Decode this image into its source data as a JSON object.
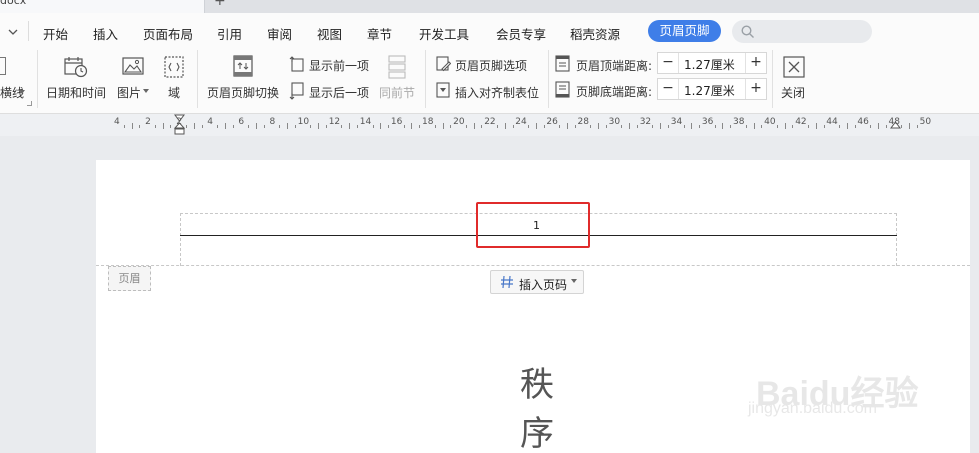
{
  "window": {
    "tab_title_fragment": "docx",
    "new_tab_symbol": "+"
  },
  "menu": {
    "items": [
      "开始",
      "插入",
      "页面布局",
      "引用",
      "审阅",
      "视图",
      "章节",
      "开发工具",
      "会员专享",
      "稻壳资源"
    ],
    "active": "页眉页脚"
  },
  "ribbon": {
    "partial_line_label": "横线",
    "date_time": "日期和时间",
    "picture": "图片",
    "field": "域",
    "switch_header_footer": "页眉页脚切换",
    "show_prev": "显示前一项",
    "show_next": "显示后一项",
    "same_as_prev": "同前节",
    "hf_options": "页眉页脚选项",
    "insert_align_tab": "插入对齐制表位",
    "header_top_distance_label": "页眉顶端距离:",
    "header_top_distance_value": "1.27厘米",
    "footer_bottom_distance_label": "页脚底端距离:",
    "footer_bottom_distance_value": "1.27厘米",
    "close": "关闭"
  },
  "ruler": {
    "numbers": [
      "4",
      "2",
      "2",
      "4",
      "6",
      "8",
      "10",
      "12",
      "14",
      "16",
      "18",
      "20",
      "22",
      "24",
      "26",
      "28",
      "30",
      "32",
      "34",
      "36",
      "38",
      "40",
      "42",
      "44",
      "46",
      "48",
      "50"
    ]
  },
  "document": {
    "page_number": "1",
    "header_tag": "页眉",
    "insert_page_number": "插入页码",
    "body_chars": [
      "秩",
      "序"
    ]
  },
  "watermark": {
    "brand": "Baidu经验",
    "url": "jingyan.baidu.com"
  },
  "colors": {
    "accent": "#3f7ee8",
    "highlight": "#e02b2b"
  }
}
